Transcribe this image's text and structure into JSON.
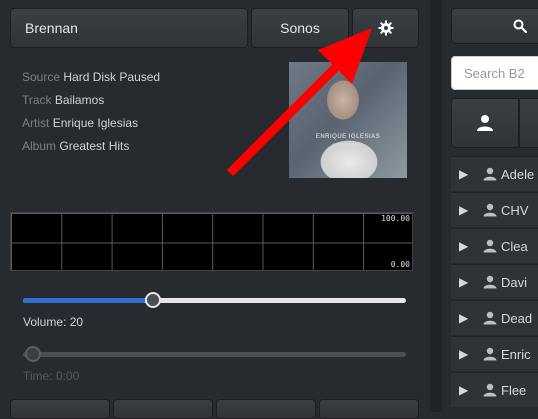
{
  "header": {
    "zone_name": "Brennan",
    "system_name": "Sonos",
    "settings_icon": "gear-icon"
  },
  "now_playing": {
    "source_label": "Source",
    "source_value": "Hard Disk Paused",
    "track_label": "Track",
    "track_value": "Bailamos",
    "artist_label": "Artist",
    "artist_value": "Enrique Iglesias",
    "album_label": "Album",
    "album_value": "Greatest Hits",
    "album_art_title": "ENRIQUE IGLESIAS",
    "album_art_subtitle": "GREATEST HITS"
  },
  "visualizer": {
    "max_label": "100.00",
    "min_label": "0.00"
  },
  "volume": {
    "label": "Volume: 20",
    "level_fraction": 0.32
  },
  "time": {
    "label": "Time: 0:00",
    "level_fraction": 0
  },
  "search": {
    "icon": "search-icon",
    "placeholder": "Search B2"
  },
  "browse": {
    "artists_tab_icon": "person-icon",
    "artists": [
      "Adele",
      "CHV",
      "Clea",
      "Davi",
      "Dead",
      "Enric",
      "Flee"
    ]
  },
  "colors": {
    "background": "#272b30",
    "accent": "#2f6fd0",
    "annotation_arrow": "#ff0000"
  }
}
